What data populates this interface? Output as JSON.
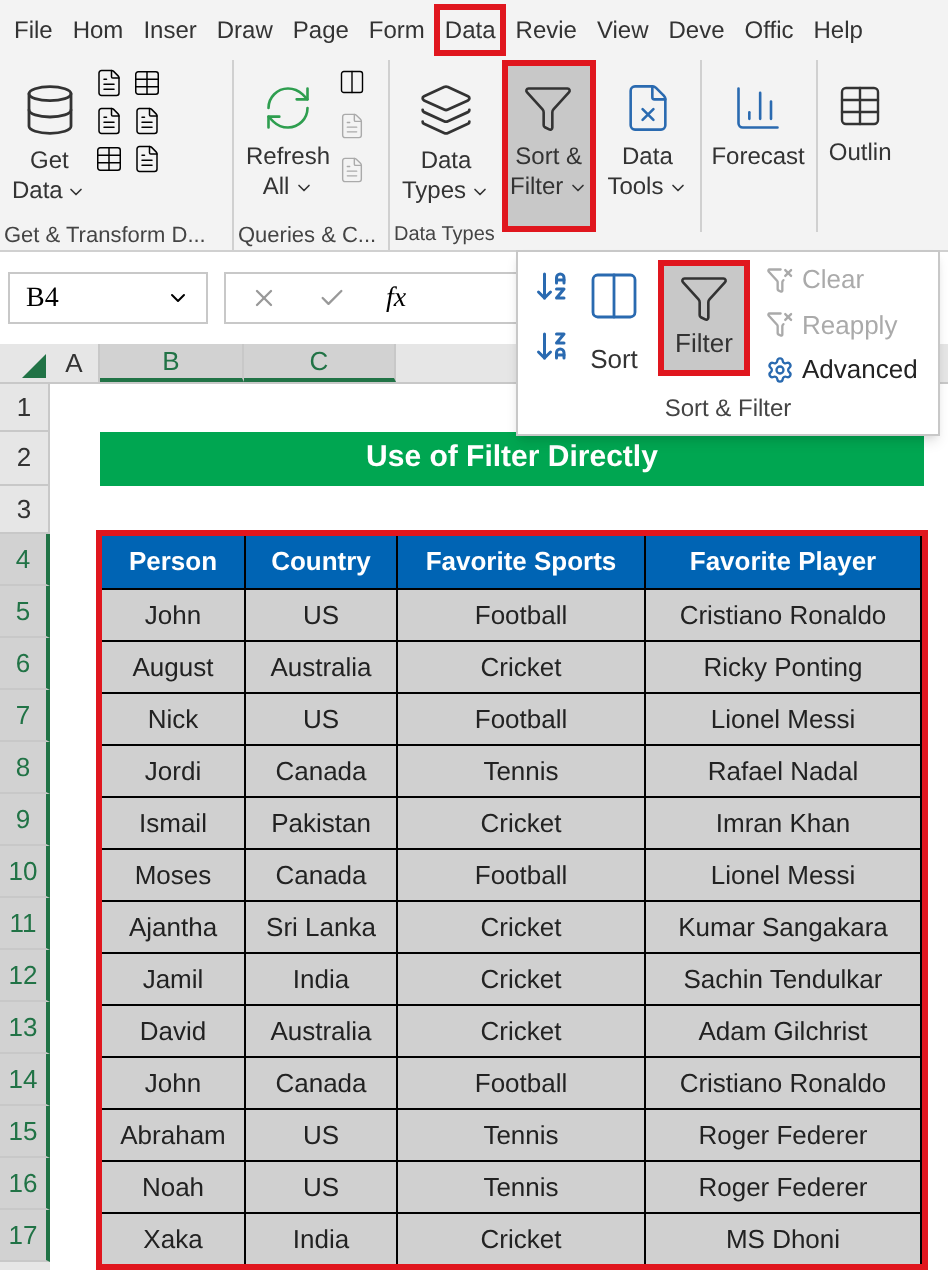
{
  "tabs": [
    {
      "label": "File",
      "selected": false
    },
    {
      "label": "Hom",
      "selected": false
    },
    {
      "label": "Inser",
      "selected": false
    },
    {
      "label": "Draw",
      "selected": false
    },
    {
      "label": "Page",
      "selected": false
    },
    {
      "label": "Form",
      "selected": false
    },
    {
      "label": "Data",
      "selected": true
    },
    {
      "label": "Revie",
      "selected": false
    },
    {
      "label": "View",
      "selected": false
    },
    {
      "label": "Deve",
      "selected": false
    },
    {
      "label": "Offic",
      "selected": false
    },
    {
      "label": "Help",
      "selected": false
    }
  ],
  "ribbon": {
    "get_data": [
      "Get",
      "Data"
    ],
    "refresh": [
      "Refresh",
      "All"
    ],
    "data_types": [
      "Data",
      "Types"
    ],
    "sort_filter": {
      "lines": [
        "Sort &",
        "Filter"
      ],
      "selected": true
    },
    "data_tools": [
      "Data",
      "Tools"
    ],
    "forecast": "Forecast",
    "outline": "Outlin",
    "group_labels": [
      "Get & Transform D...",
      "Queries & C...",
      "Data Types"
    ]
  },
  "formula_bar": {
    "name_box": "B4",
    "function_label": "fx"
  },
  "popup": {
    "sort": "Sort",
    "filter": {
      "label": "Filter",
      "selected": true
    },
    "side_items": [
      {
        "label": "Clear",
        "disabled": true
      },
      {
        "label": "Reapply",
        "disabled": true
      },
      {
        "label": "Advanced",
        "disabled": false
      }
    ],
    "title": "Sort & Filter"
  },
  "sheet": {
    "column_headers": [
      {
        "label": "A",
        "selected": false
      },
      {
        "label": "B",
        "selected": true
      },
      {
        "label": "C",
        "selected": true
      }
    ],
    "row_headers": [
      {
        "label": "1",
        "selected": false
      },
      {
        "label": "2",
        "selected": false
      },
      {
        "label": "3",
        "selected": false
      },
      {
        "label": "4",
        "selected": true
      },
      {
        "label": "5",
        "selected": true
      },
      {
        "label": "6",
        "selected": true
      },
      {
        "label": "7",
        "selected": true
      },
      {
        "label": "8",
        "selected": true
      },
      {
        "label": "9",
        "selected": true
      },
      {
        "label": "10",
        "selected": true
      },
      {
        "label": "11",
        "selected": true
      },
      {
        "label": "12",
        "selected": true
      },
      {
        "label": "13",
        "selected": true
      },
      {
        "label": "14",
        "selected": true
      },
      {
        "label": "15",
        "selected": true
      },
      {
        "label": "16",
        "selected": true
      },
      {
        "label": "17",
        "selected": true
      }
    ],
    "banner": "Use of Filter Directly",
    "table": {
      "columns": [
        "Person",
        "Country",
        "Favorite Sports",
        "Favorite Player"
      ],
      "rows": [
        [
          "John",
          "US",
          "Football",
          "Cristiano Ronaldo"
        ],
        [
          "August",
          "Australia",
          "Cricket",
          "Ricky Ponting"
        ],
        [
          "Nick",
          "US",
          "Football",
          "Lionel Messi"
        ],
        [
          "Jordi",
          "Canada",
          "Tennis",
          "Rafael Nadal"
        ],
        [
          "Ismail",
          "Pakistan",
          "Cricket",
          "Imran Khan"
        ],
        [
          "Moses",
          "Canada",
          "Football",
          "Lionel Messi"
        ],
        [
          "Ajantha",
          "Sri Lanka",
          "Cricket",
          "Kumar Sangakara"
        ],
        [
          "Jamil",
          "India",
          "Cricket",
          "Sachin Tendulkar"
        ],
        [
          "David",
          "Australia",
          "Cricket",
          "Adam Gilchrist"
        ],
        [
          "John",
          "Canada",
          "Football",
          "Cristiano Ronaldo"
        ],
        [
          "Abraham",
          "US",
          "Tennis",
          "Roger Federer"
        ],
        [
          "Noah",
          "US",
          "Tennis",
          "Roger Federer"
        ],
        [
          "Xaka",
          "India",
          "Cricket",
          "MS Dhoni"
        ]
      ]
    }
  }
}
